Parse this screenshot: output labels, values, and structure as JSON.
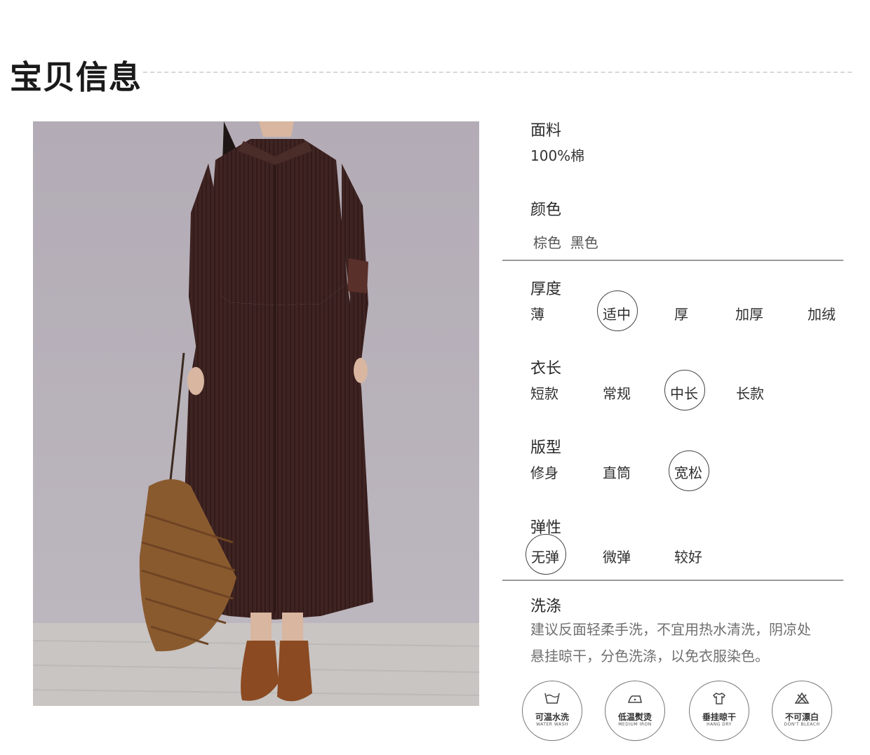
{
  "header": {
    "title": "宝贝信息"
  },
  "fabric": {
    "label": "面料",
    "value": "100%棉"
  },
  "color": {
    "label": "颜色",
    "value": "棕色  黑色"
  },
  "thickness": {
    "label": "厚度",
    "options": [
      "薄",
      "适中",
      "厚",
      "加厚",
      "加绒"
    ],
    "selected": "适中"
  },
  "length": {
    "label": "衣长",
    "options": [
      "短款",
      "常规",
      "中长",
      "长款"
    ],
    "selected": "中长"
  },
  "fit": {
    "label": "版型",
    "options": [
      "修身",
      "直筒",
      "宽松"
    ],
    "selected": "宽松"
  },
  "elasticity": {
    "label": "弹性",
    "options": [
      "无弹",
      "微弹",
      "较好"
    ],
    "selected": "无弹"
  },
  "washing": {
    "label": "洗涤",
    "text_line1": "建议反面轻柔手洗，不宜用热水清洗，阴凉处",
    "text_line2": "悬挂晾干，分色洗涤，以免衣服染色。"
  },
  "care_icons": [
    {
      "icon": "wash-tub-icon",
      "cn": "可温水洗",
      "en": "WATER WASH"
    },
    {
      "icon": "iron-icon",
      "cn": "低温熨烫",
      "en": "MEDIUM IRON"
    },
    {
      "icon": "hang-shirt-icon",
      "cn": "垂挂晾干",
      "en": "HANG DRY"
    },
    {
      "icon": "no-bleach-icon",
      "cn": "不可漂白",
      "en": "DON'T BLEACH"
    }
  ],
  "colors": {
    "dress": "#3e2422",
    "backdrop": "#b7b0ba",
    "floor": "#c9c6c4",
    "boots": "#8b4a22",
    "bag": "#8a5a2f"
  }
}
